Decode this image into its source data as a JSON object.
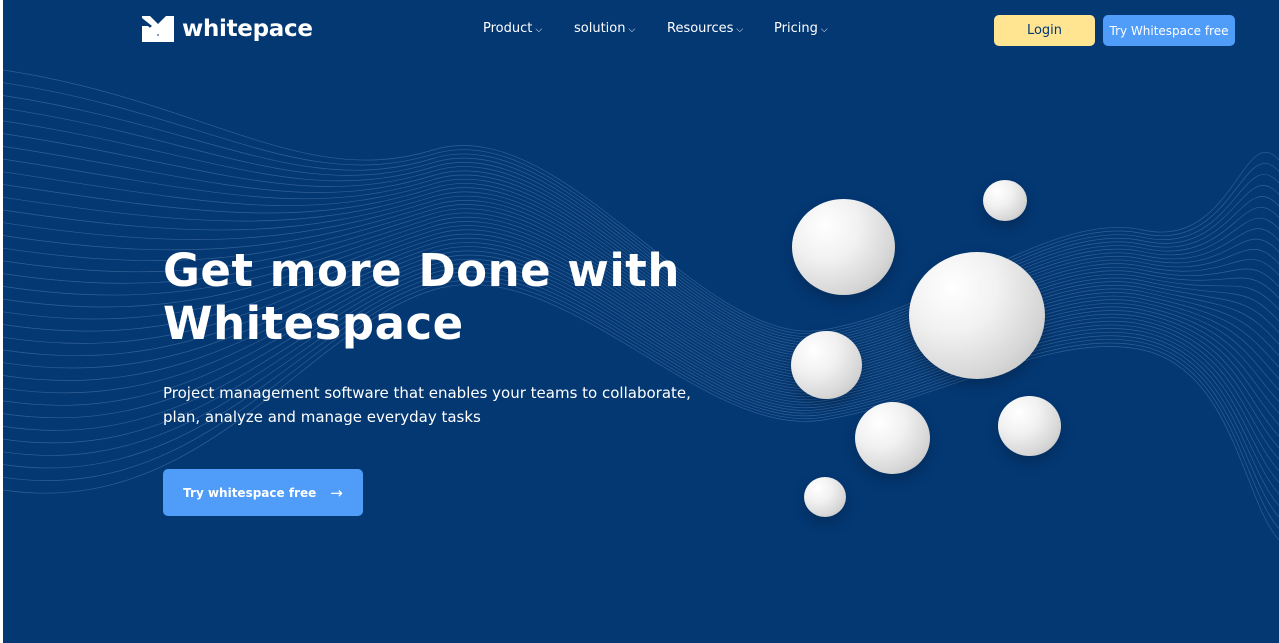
{
  "brand": {
    "name": "whitepace",
    "background_color": "#043873",
    "accent_color": "#4f9cf9",
    "login_color": "#ffe492"
  },
  "nav": {
    "items": [
      {
        "label": "Product",
        "icon": "chevron-down-icon"
      },
      {
        "label": "solution",
        "icon": "chevron-down-icon"
      },
      {
        "label": "Resources",
        "icon": "chevron-down-icon"
      },
      {
        "label": "Pricing",
        "icon": "chevron-down-icon"
      }
    ],
    "login_label": "Login",
    "try_label": "Try Whitespace free"
  },
  "hero": {
    "title_line1": "Get more Done with",
    "title_line2": "Whitespace",
    "subtitle_line1": "Project management software that enables your teams to collaborate,",
    "subtitle_line2": "plan, analyze and manage everyday tasks",
    "cta_label": "Try whitespace free",
    "cta_icon": "arrow-right-icon"
  }
}
